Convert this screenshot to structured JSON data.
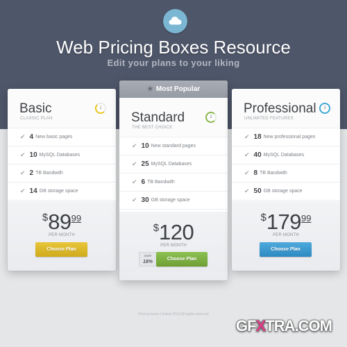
{
  "header": {
    "logo_icon": "cloud-icon",
    "title": "Web Pricing Boxes Resource",
    "subtitle": "Edit your plans to your liking"
  },
  "plans": [
    {
      "name": "Basic",
      "tagline": "CLASSIC PLAN",
      "badge": "1",
      "badge_color": "#e8c41d",
      "features": [
        {
          "num": "4",
          "text": "New basic pages"
        },
        {
          "num": "10",
          "text": "MySQL Databases"
        },
        {
          "num": "2",
          "text": "TB Bandwith"
        },
        {
          "num": "14",
          "text": "GB storage space"
        }
      ],
      "currency": "$",
      "price": "89",
      "cents": "99",
      "period": "PER MONTH",
      "button": "Choose Plan",
      "button_color": "#d9b52a"
    },
    {
      "ribbon": "Most Popular",
      "ribbon_icon": "star-icon",
      "name": "Standard",
      "tagline": "THE BEST CHOICE",
      "badge": "2",
      "badge_color": "#8ab74a",
      "features": [
        {
          "num": "10",
          "text": "New standard pages"
        },
        {
          "num": "25",
          "text": "MySQL Databases"
        },
        {
          "num": "6",
          "text": "TB Bandwith"
        },
        {
          "num": "30",
          "text": "GB storage space"
        }
      ],
      "currency": "$",
      "price": "120",
      "period": "PER MONTH",
      "save_label": "save",
      "save_value": "18%",
      "button": "Choose Plan",
      "button_color": "#7db044"
    },
    {
      "name": "Professional",
      "tagline": "UNLIMITED FEATURES",
      "badge": "3",
      "badge_color": "#3fa7d4",
      "features": [
        {
          "num": "18",
          "text": "New professional pages"
        },
        {
          "num": "40",
          "text": "MySQL Databases"
        },
        {
          "num": "8",
          "text": "TB Bandwith"
        },
        {
          "num": "50",
          "text": "GB storage space"
        }
      ],
      "currency": "$",
      "price": "179",
      "cents": "99",
      "period": "PER MONTH",
      "button": "Choose Plan",
      "button_color": "#3a98cf"
    }
  ],
  "footer": {
    "copyright": "Pricing boxes Limited 2013 All rights reserved"
  },
  "watermark": {
    "pre": "GF",
    "x": "X",
    "post": "TRA.COM"
  }
}
